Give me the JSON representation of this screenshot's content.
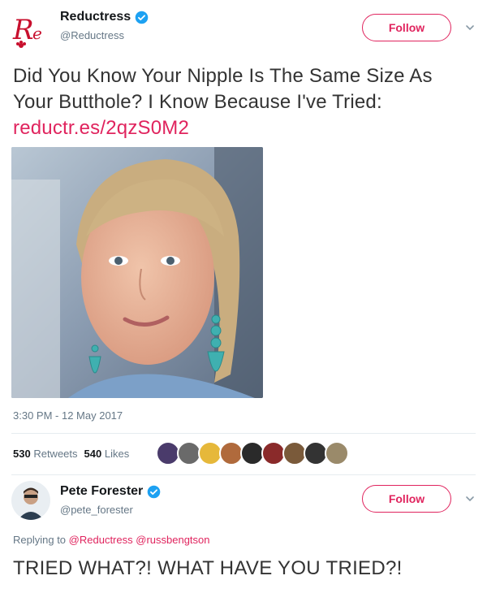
{
  "tweet": {
    "author": {
      "display_name": "Reductress",
      "handle": "@Reductress",
      "verified": true,
      "avatar_icon": "reductress-logo-icon"
    },
    "follow_label": "Follow",
    "text": "Did You Know Your Nipple Is The Same Size As Your Butthole? I Know Because I've Tried:",
    "link": "reductr.es/2qzS0M2",
    "timestamp": "3:30 PM - 12 May 2017",
    "retweets": {
      "count": "530",
      "label": "Retweets"
    },
    "likes": {
      "count": "540",
      "label": "Likes"
    },
    "liker_avatar_colors": [
      "#4a3b6b",
      "#6a6a6a",
      "#e6b83a",
      "#b06a3c",
      "#2a2a2a",
      "#8a2a2a",
      "#7a5a3a",
      "#333333",
      "#9a8a6a"
    ]
  },
  "reply": {
    "author": {
      "display_name": "Pete Forester",
      "handle": "@pete_forester",
      "verified": true
    },
    "follow_label": "Follow",
    "replying_to_label": "Replying to",
    "mentions": [
      "@Reductress",
      "@russbengtson"
    ],
    "text": "TRIED WHAT?! WHAT HAVE YOU TRIED?!"
  },
  "colors": {
    "accent": "#e0245e",
    "verified": "#1da1f2",
    "muted": "#657786"
  }
}
